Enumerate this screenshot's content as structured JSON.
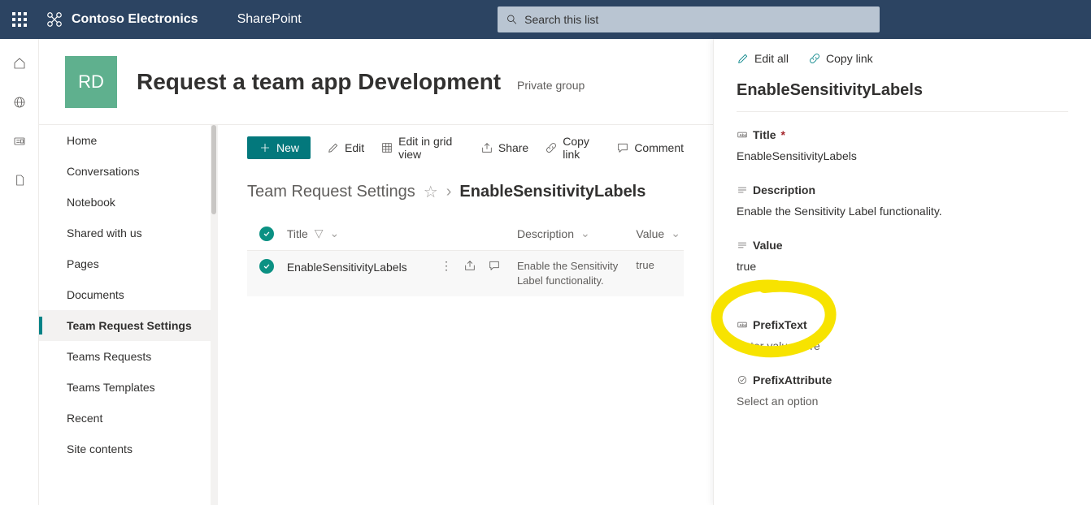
{
  "suite": {
    "brand": "Contoso Electronics",
    "app": "SharePoint",
    "search_placeholder": "Search this list"
  },
  "site": {
    "logo_initials": "RD",
    "title": "Request a team app Development",
    "privacy": "Private group"
  },
  "nav": {
    "items": [
      "Home",
      "Conversations",
      "Notebook",
      "Shared with us",
      "Pages",
      "Documents",
      "Team Request Settings",
      "Teams Requests",
      "Teams Templates",
      "Recent",
      "Site contents"
    ],
    "active_index": 6
  },
  "commands": {
    "new": "New",
    "edit": "Edit",
    "edit_grid": "Edit in grid view",
    "share": "Share",
    "copy_link": "Copy link",
    "comment": "Comment"
  },
  "breadcrumb": {
    "list_name": "Team Request Settings",
    "current_item": "EnableSensitivityLabels"
  },
  "columns": {
    "title": "Title",
    "description": "Description",
    "value": "Value"
  },
  "row": {
    "title": "EnableSensitivityLabels",
    "description": "Enable the Sensitivity Label functionality.",
    "value": "true"
  },
  "panel": {
    "edit_all": "Edit all",
    "copy_link": "Copy link",
    "item_title": "EnableSensitivityLabels",
    "fields": {
      "title": {
        "label": "Title",
        "value": "EnableSensitivityLabels",
        "required": true
      },
      "description": {
        "label": "Description",
        "value": "Enable the Sensitivity Label functionality."
      },
      "value": {
        "label": "Value",
        "value": "true"
      },
      "prefix_text": {
        "label": "PrefixText",
        "placeholder": "Enter value here"
      },
      "prefix_attribute": {
        "label": "PrefixAttribute",
        "placeholder": "Select an option"
      }
    }
  }
}
